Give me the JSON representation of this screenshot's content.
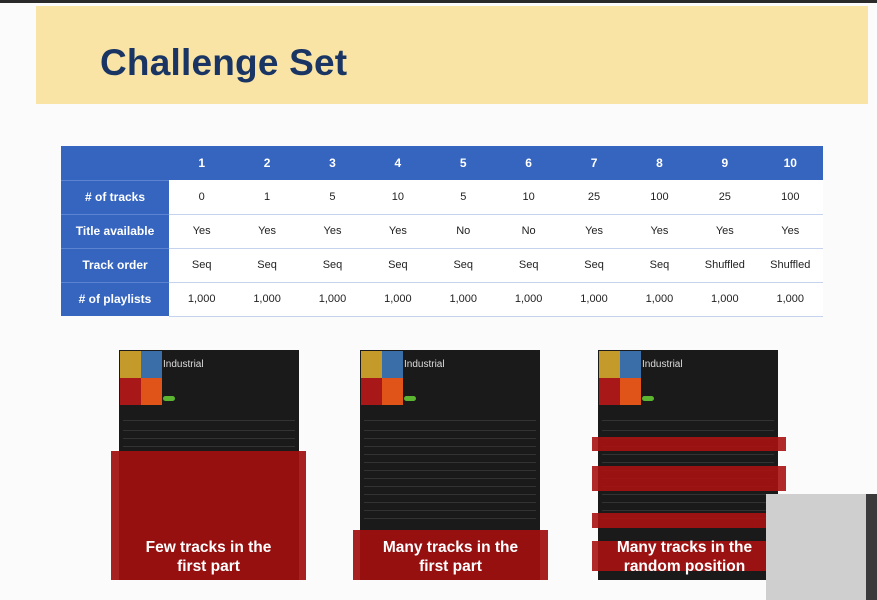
{
  "slide": {
    "title": "Challenge Set"
  },
  "table": {
    "columns": [
      "1",
      "2",
      "3",
      "4",
      "5",
      "6",
      "7",
      "8",
      "9",
      "10"
    ],
    "rows": [
      {
        "label": "# of tracks",
        "values": [
          "0",
          "1",
          "5",
          "10",
          "5",
          "10",
          "25",
          "100",
          "25",
          "100"
        ]
      },
      {
        "label": "Title available",
        "values": [
          "Yes",
          "Yes",
          "Yes",
          "Yes",
          "No",
          "No",
          "Yes",
          "Yes",
          "Yes",
          "Yes"
        ]
      },
      {
        "label": "Track order",
        "values": [
          "Seq",
          "Seq",
          "Seq",
          "Seq",
          "Seq",
          "Seq",
          "Seq",
          "Seq",
          "Shuffled",
          "Shuffled"
        ]
      },
      {
        "label": "# of playlists",
        "values": [
          "1,000",
          "1,000",
          "1,000",
          "1,000",
          "1,000",
          "1,000",
          "1,000",
          "1,000",
          "1,000",
          "1,000"
        ]
      }
    ]
  },
  "examples": [
    {
      "playlist_name": "Industrial",
      "caption_line1": "Few tracks in the",
      "caption_line2": "first part"
    },
    {
      "playlist_name": "Industrial",
      "caption_line1": "Many tracks in the",
      "caption_line2": "first part"
    },
    {
      "playlist_name": "Industrial",
      "caption_line1": "Many tracks in the",
      "caption_line2": "random position"
    }
  ]
}
